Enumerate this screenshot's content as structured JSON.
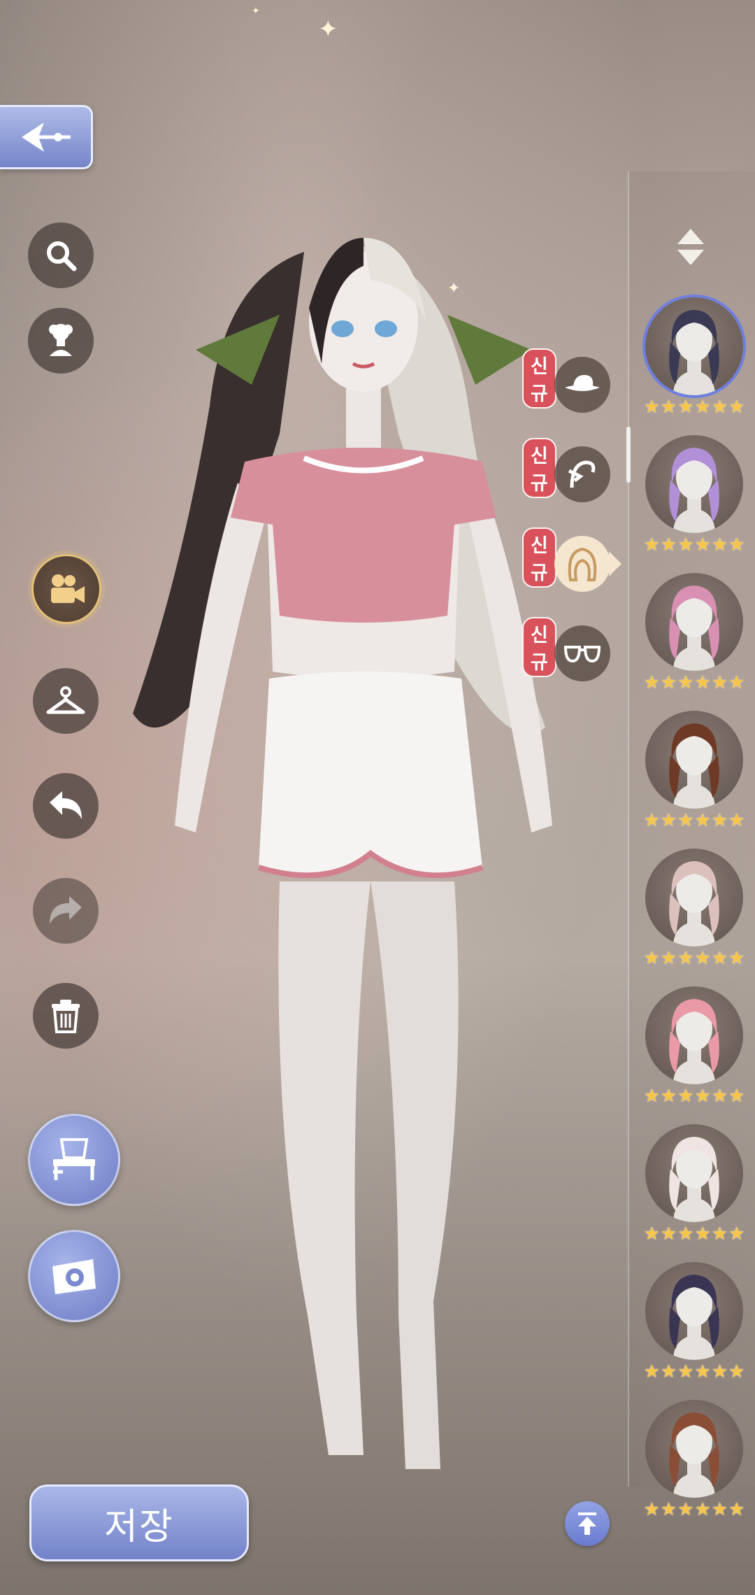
{
  "colors": {
    "accent": "#7585c9",
    "badge": "#d9515a",
    "star": "#f6c54a",
    "active_ring": "#e5c079"
  },
  "header": {
    "back_icon": "back-arrow-icon"
  },
  "left_toolbar": {
    "buttons": [
      {
        "name": "search",
        "icon": "search-icon"
      },
      {
        "name": "flower-bust",
        "icon": "flower-mannequin-icon"
      },
      {
        "name": "camera-mode",
        "icon": "movie-camera-icon",
        "active": true
      },
      {
        "name": "wardrobe",
        "icon": "hanger-icon"
      },
      {
        "name": "undo",
        "icon": "undo-icon"
      },
      {
        "name": "redo",
        "icon": "redo-icon",
        "disabled": true
      },
      {
        "name": "delete",
        "icon": "trash-icon"
      },
      {
        "name": "dresser",
        "icon": "vanity-table-icon"
      },
      {
        "name": "screenshot",
        "icon": "camera-icon"
      }
    ]
  },
  "categories": [
    {
      "badge": "신규",
      "icon": "hat-icon"
    },
    {
      "badge": "신규",
      "icon": "hair-accessory-icon"
    },
    {
      "badge": "신규",
      "icon": "hair-icon",
      "selected": true
    },
    {
      "badge": "신규",
      "icon": "glasses-icon"
    }
  ],
  "right_panel": {
    "sort_icon": "sort-updown-icon",
    "items": [
      {
        "hair_color": "#3b3a55",
        "stars": 6
      },
      {
        "hair_color": "#b190d8",
        "stars": 6
      },
      {
        "hair_color": "#d990b3",
        "stars": 6
      },
      {
        "hair_color": "#6e3a26",
        "stars": 6
      },
      {
        "hair_color": "#dcc0bb",
        "stars": 6
      },
      {
        "hair_color": "#e99aa6",
        "stars": 6
      },
      {
        "hair_color": "#efe4e2",
        "stars": 6
      },
      {
        "hair_color": "#3a3553",
        "stars": 6
      },
      {
        "hair_color": "#8a4e36",
        "stars": 6
      }
    ]
  },
  "footer": {
    "save_label": "저장",
    "scroll_top_icon": "scroll-to-top-icon"
  }
}
